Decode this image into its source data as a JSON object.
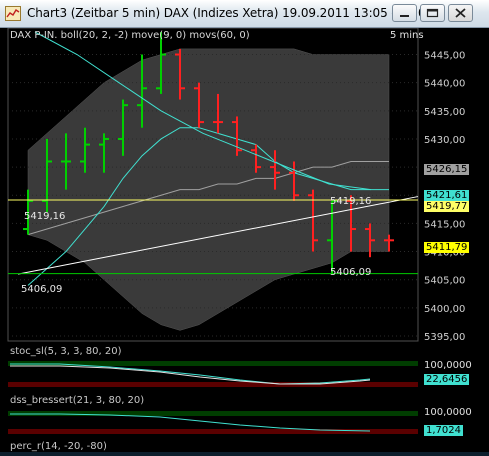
{
  "window": {
    "title": "Chart3 (Zeitbar 5 min)  DAX (Indizes Xetra) 19.09.2011 13:05 - 19.0...",
    "buttons": [
      "minimize",
      "maximize",
      "close"
    ]
  },
  "main_panel": {
    "indicator_label": "DAX P-IN. boll(20, 2, -2) move(9, 0) movs(60, 0)",
    "timeframe_label": "5 mins",
    "y_ticks": [
      "5445,00",
      "5440,00",
      "5435,00",
      "5430,00",
      "5425,00",
      "5420,00",
      "5415,00",
      "5410,00",
      "5405,00",
      "5400,00",
      "5395,00"
    ],
    "price_tags": {
      "gray": "5426,15",
      "cyan": "5421,61",
      "yellow_line": "5419,77",
      "last": "5411,79"
    },
    "annotations": {
      "support_left": "5419,16",
      "support_right": "5419,16",
      "low_left": "5406,09",
      "low_right": "5406,09"
    }
  },
  "stoch_panel": {
    "label": "stoc_sl(5, 3, 3, 80, 20)",
    "upper_value": "100,0000",
    "current_value": "22,6456"
  },
  "dss_panel": {
    "label": "dss_bressert(21, 3, 80, 20)",
    "upper_value": "100,0000",
    "current_value": "1,7024"
  },
  "perc_panel": {
    "label": "perc_r(14, -20, -80)"
  },
  "colors": {
    "up_bar": "#00d000",
    "down_bar": "#ff2020",
    "bollinger_fill": "#3a3a3a",
    "ma_fast": "#40e0d0",
    "ma_slow": "#a0a0a0",
    "trendline": "#ffffff",
    "support_line": "#ffff66",
    "low_line": "#00cc00"
  },
  "chart_data": {
    "type": "candlestick",
    "instrument": "DAX (Indizes Xetra)",
    "interval": "5 min",
    "y_range": [
      5395,
      5449
    ],
    "bars": [
      {
        "o": 5414,
        "h": 5421,
        "l": 5413,
        "c": 5419,
        "dir": "up"
      },
      {
        "o": 5419,
        "h": 5430,
        "l": 5417,
        "c": 5426,
        "dir": "up"
      },
      {
        "o": 5426,
        "h": 5431,
        "l": 5421,
        "c": 5426,
        "dir": "up"
      },
      {
        "o": 5426,
        "h": 5432,
        "l": 5424,
        "c": 5429,
        "dir": "up"
      },
      {
        "o": 5429,
        "h": 5431,
        "l": 5424,
        "c": 5430,
        "dir": "up"
      },
      {
        "o": 5430,
        "h": 5437,
        "l": 5427,
        "c": 5436,
        "dir": "up"
      },
      {
        "o": 5436,
        "h": 5445,
        "l": 5432,
        "c": 5439,
        "dir": "up"
      },
      {
        "o": 5439,
        "h": 5449,
        "l": 5438,
        "c": 5445,
        "dir": "up"
      },
      {
        "o": 5445,
        "h": 5446,
        "l": 5437,
        "c": 5439,
        "dir": "down"
      },
      {
        "o": 5439,
        "h": 5440,
        "l": 5432,
        "c": 5433,
        "dir": "down"
      },
      {
        "o": 5433,
        "h": 5438,
        "l": 5431,
        "c": 5433,
        "dir": "down"
      },
      {
        "o": 5433,
        "h": 5434,
        "l": 5427,
        "c": 5428,
        "dir": "down"
      },
      {
        "o": 5428,
        "h": 5429,
        "l": 5424,
        "c": 5425,
        "dir": "down"
      },
      {
        "o": 5425,
        "h": 5428,
        "l": 5421,
        "c": 5424,
        "dir": "down"
      },
      {
        "o": 5424,
        "h": 5426,
        "l": 5419,
        "c": 5420,
        "dir": "down"
      },
      {
        "o": 5420,
        "h": 5421,
        "l": 5410,
        "c": 5412,
        "dir": "down"
      },
      {
        "o": 5412,
        "h": 5419,
        "l": 5406,
        "c": 5419,
        "dir": "up"
      },
      {
        "o": 5419,
        "h": 5420,
        "l": 5410,
        "c": 5414,
        "dir": "down"
      },
      {
        "o": 5414,
        "h": 5415,
        "l": 5409,
        "c": 5412,
        "dir": "down"
      },
      {
        "o": 5412,
        "h": 5413,
        "l": 5410,
        "c": 5412,
        "dir": "down"
      }
    ],
    "series": [
      {
        "name": "move(9, 0)",
        "values": [
          5404,
          5407,
          5410,
          5414,
          5418,
          5423,
          5427,
          5430,
          5432,
          5432,
          5431,
          5430,
          5429,
          5426,
          5424,
          5423,
          5422,
          5421,
          5421,
          5421
        ]
      },
      {
        "name": "movs(60, 0)",
        "values": [
          5413,
          5414,
          5415,
          5416,
          5417,
          5418,
          5419,
          5420,
          5421,
          5421,
          5422,
          5422,
          5423,
          5423,
          5424,
          5425,
          5425,
          5426,
          5426,
          5426
        ]
      },
      {
        "name": "boll upper",
        "values": [
          5428,
          5431,
          5434,
          5437,
          5440,
          5442,
          5444,
          5445,
          5446,
          5446,
          5446,
          5446,
          5446,
          5446,
          5446,
          5445,
          5445,
          5445,
          5445,
          5445
        ]
      },
      {
        "name": "boll lower",
        "values": [
          5413,
          5412,
          5410,
          5408,
          5405,
          5402,
          5399,
          5397,
          5396,
          5397,
          5399,
          5401,
          5403,
          5405,
          5406,
          5407,
          5408,
          5410,
          5410,
          5410
        ]
      },
      {
        "name": "trend descending",
        "values": [
          5449,
          5445,
          5440,
          5435,
          5431,
          5428,
          5425,
          5422,
          5421
        ]
      },
      {
        "name": "trend ascending",
        "values": [
          5406,
          5419.77
        ]
      }
    ]
  }
}
